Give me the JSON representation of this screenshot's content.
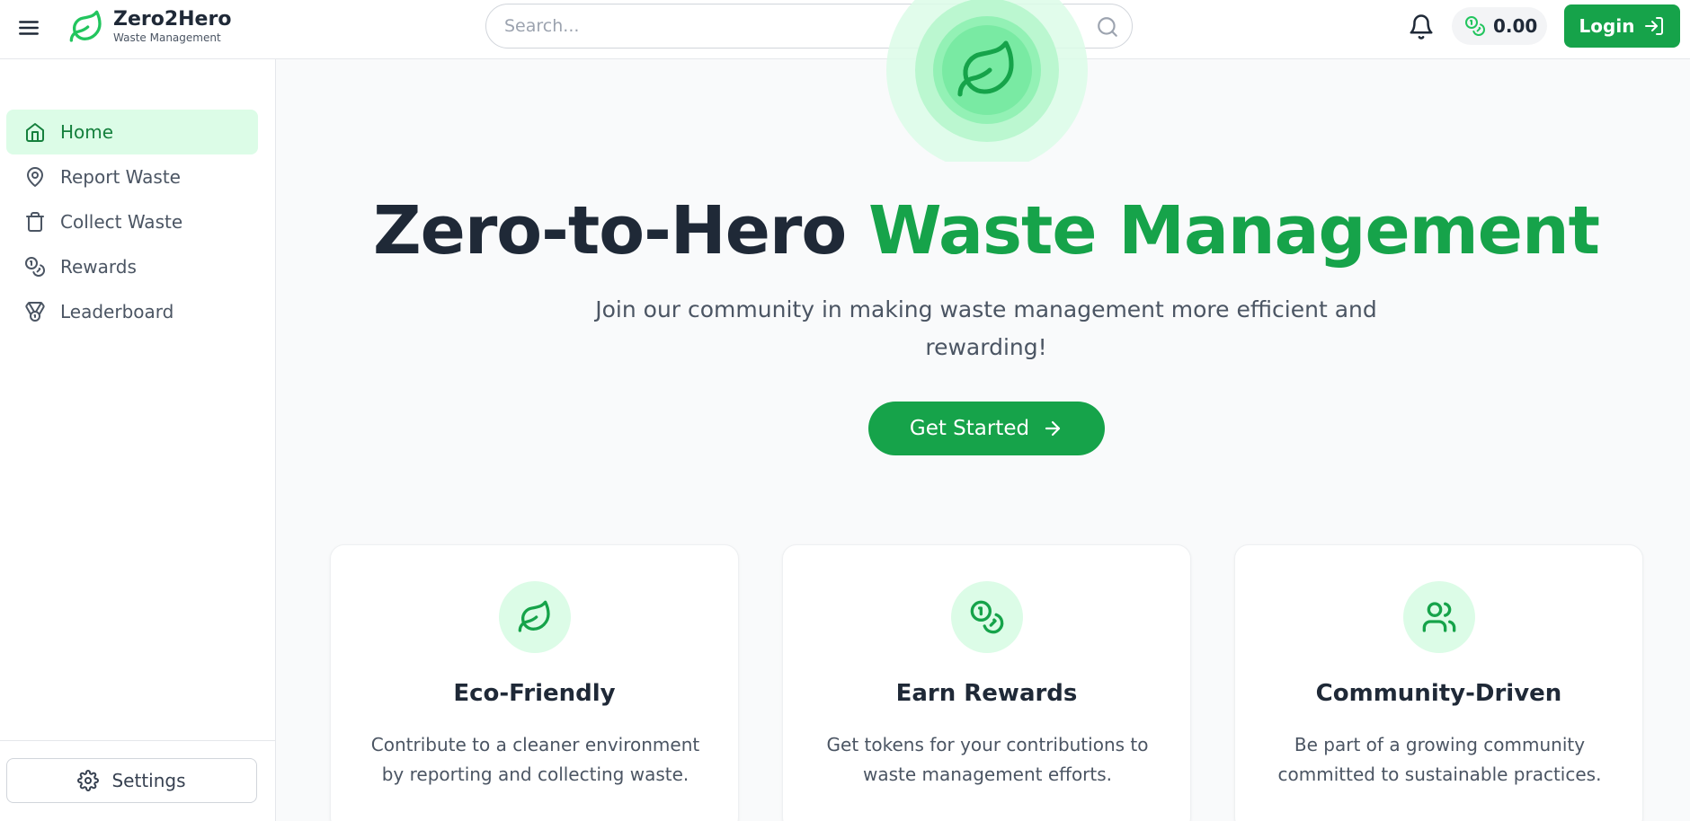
{
  "header": {
    "app_title": "Zero2Hero",
    "app_subtitle": "Waste Management",
    "search_placeholder": "Search...",
    "balance": "0.00",
    "login_label": "Login",
    "icons": [
      "menu-icon",
      "leaf-icon",
      "search-icon",
      "bell-icon",
      "coins-icon",
      "log-in-icon"
    ]
  },
  "sidebar": {
    "items": [
      {
        "label": "Home",
        "icon": "home-icon",
        "active": true
      },
      {
        "label": "Report Waste",
        "icon": "map-pin-icon",
        "active": false
      },
      {
        "label": "Collect Waste",
        "icon": "trash-icon",
        "active": false
      },
      {
        "label": "Rewards",
        "icon": "coins-icon",
        "active": false
      },
      {
        "label": "Leaderboard",
        "icon": "medal-icon",
        "active": false
      }
    ],
    "settings_label": "Settings"
  },
  "hero": {
    "title_part1": "Zero-to-Hero",
    "title_part2": "Waste Management",
    "subtitle": "Join our community in making waste management more efficient and rewarding!",
    "cta_label": "Get Started"
  },
  "features": [
    {
      "title": "Eco-Friendly",
      "description": "Contribute to a cleaner environment by reporting and collecting waste.",
      "icon": "leaf-icon"
    },
    {
      "title": "Earn Rewards",
      "description": "Get tokens for your contributions to waste management efforts.",
      "icon": "coins-icon"
    },
    {
      "title": "Community-Driven",
      "description": "Be part of a growing community committed to sustainable practices.",
      "icon": "users-icon"
    }
  ],
  "colors": {
    "accent": "#16a34a",
    "accent_light": "#dcfce7",
    "text_dark": "#1f2937",
    "text_muted": "#4b5563"
  }
}
